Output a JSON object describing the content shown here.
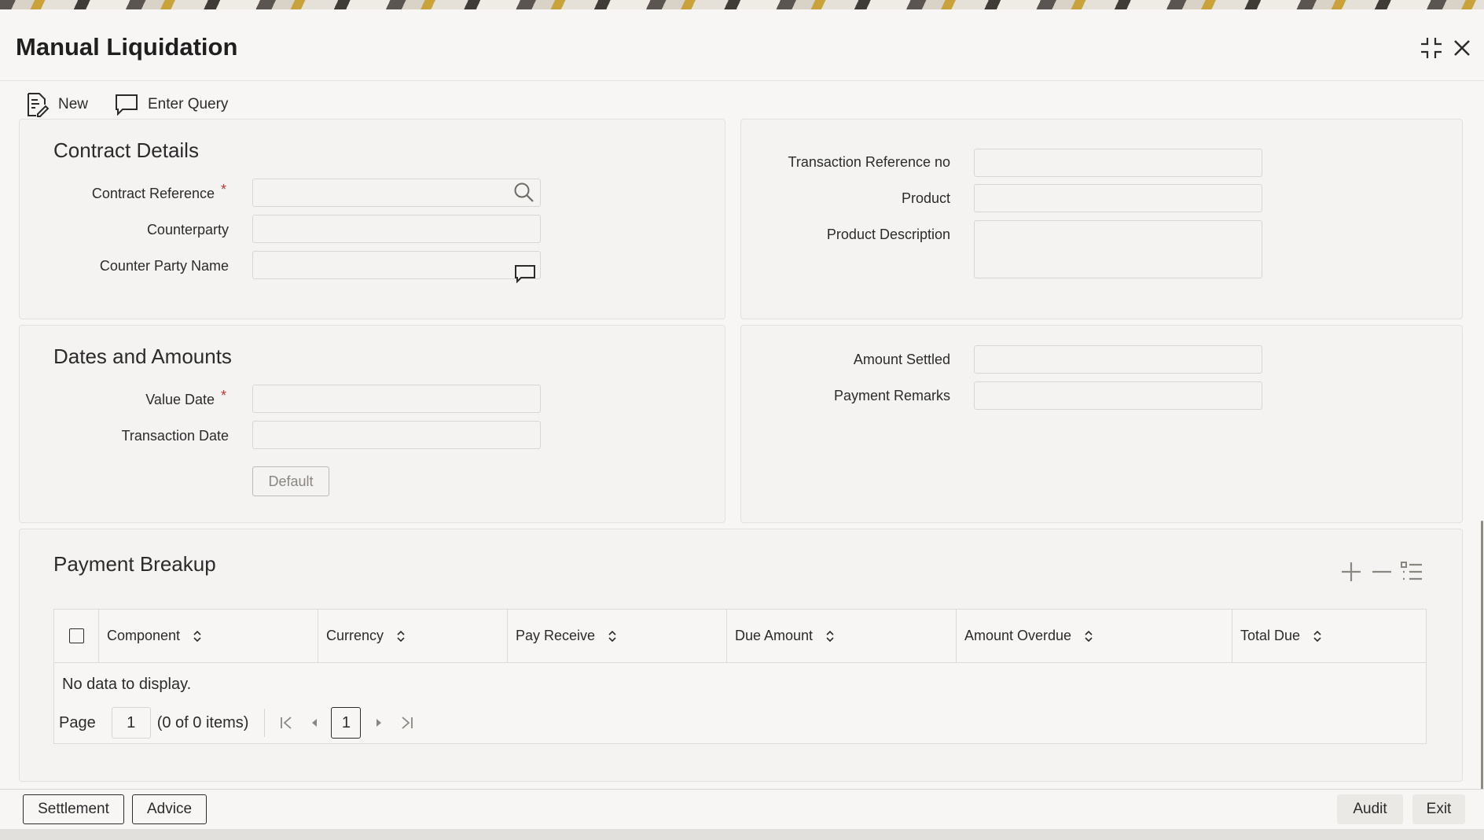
{
  "window": {
    "title": "Manual Liquidation"
  },
  "toolbar": {
    "new_label": "New",
    "enter_query_label": "Enter Query"
  },
  "contract_details": {
    "title": "Contract Details",
    "contract_reference_label": "Contract Reference",
    "contract_reference_value": "",
    "counterparty_label": "Counterparty",
    "counterparty_value": "",
    "counter_party_name_label": "Counter Party Name",
    "counter_party_name_value": "",
    "required_mark": "*"
  },
  "transaction_info": {
    "transaction_reference_label": "Transaction Reference no",
    "transaction_reference_value": "",
    "product_label": "Product",
    "product_value": "",
    "product_description_label": "Product Description",
    "product_description_value": ""
  },
  "dates_amounts": {
    "title": "Dates and Amounts",
    "value_date_label": "Value Date",
    "value_date_value": "",
    "transaction_date_label": "Transaction Date",
    "transaction_date_value": "",
    "default_button": "Default",
    "required_mark": "*"
  },
  "settlement_info": {
    "amount_settled_label": "Amount Settled",
    "amount_settled_value": "",
    "payment_remarks_label": "Payment Remarks",
    "payment_remarks_value": ""
  },
  "payment_breakup": {
    "title": "Payment Breakup",
    "columns": [
      "Component",
      "Currency",
      "Pay Receive",
      "Due Amount",
      "Amount Overdue",
      "Total Due"
    ],
    "no_data": "No data to display.",
    "pager": {
      "page_label": "Page",
      "page_input": "1",
      "items_text": "(0 of 0 items)",
      "current_page": "1"
    }
  },
  "footer": {
    "settlement": "Settlement",
    "advice": "Advice",
    "audit": "Audit",
    "exit": "Exit"
  },
  "icons": {
    "new": "new-document-icon",
    "enter_query": "speech-bubble-icon",
    "search": "search-icon",
    "lov": "speech-bubble-icon",
    "add": "plus-icon",
    "remove": "minus-icon",
    "details": "list-icon",
    "sort": "sort-icon",
    "minimize": "collapse-icon",
    "close": "close-icon"
  },
  "colors": {
    "required": "#c0392b",
    "text": "#2b2b2b",
    "panel_bg": "#f4f3f1"
  }
}
